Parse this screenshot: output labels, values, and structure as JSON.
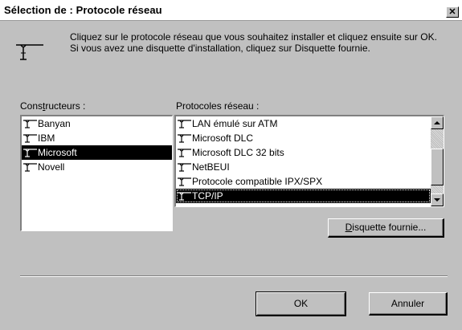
{
  "window": {
    "title": "Sélection de : Protocole réseau",
    "close_label": "✕"
  },
  "intro": {
    "text": "Cliquez sur le protocole réseau que vous souhaitez installer et cliquez ensuite sur OK. Si vous avez une disquette d'installation, cliquez sur Disquette fournie."
  },
  "manufacturers": {
    "label_pre": "Cons",
    "label_key": "t",
    "label_post": "ructeurs :",
    "items": [
      {
        "label": "Banyan",
        "selected": false
      },
      {
        "label": "IBM",
        "selected": false
      },
      {
        "label": "Microsoft",
        "selected": true
      },
      {
        "label": "Novell",
        "selected": false
      }
    ]
  },
  "protocols": {
    "label": "Protocoles réseau :",
    "items": [
      {
        "label": "LAN émulé sur ATM",
        "selected": false
      },
      {
        "label": "Microsoft DLC",
        "selected": false
      },
      {
        "label": "Microsoft DLC 32 bits",
        "selected": false
      },
      {
        "label": "NetBEUI",
        "selected": false
      },
      {
        "label": "Protocole compatible IPX/SPX",
        "selected": false
      },
      {
        "label": "TCP/IP",
        "selected": true
      }
    ]
  },
  "buttons": {
    "disk_key": "D",
    "disk_rest": "isquette fournie...",
    "ok": "OK",
    "cancel": "Annuler"
  },
  "icons": {
    "network": "network-protocol-icon",
    "item": "network-cable-icon"
  }
}
